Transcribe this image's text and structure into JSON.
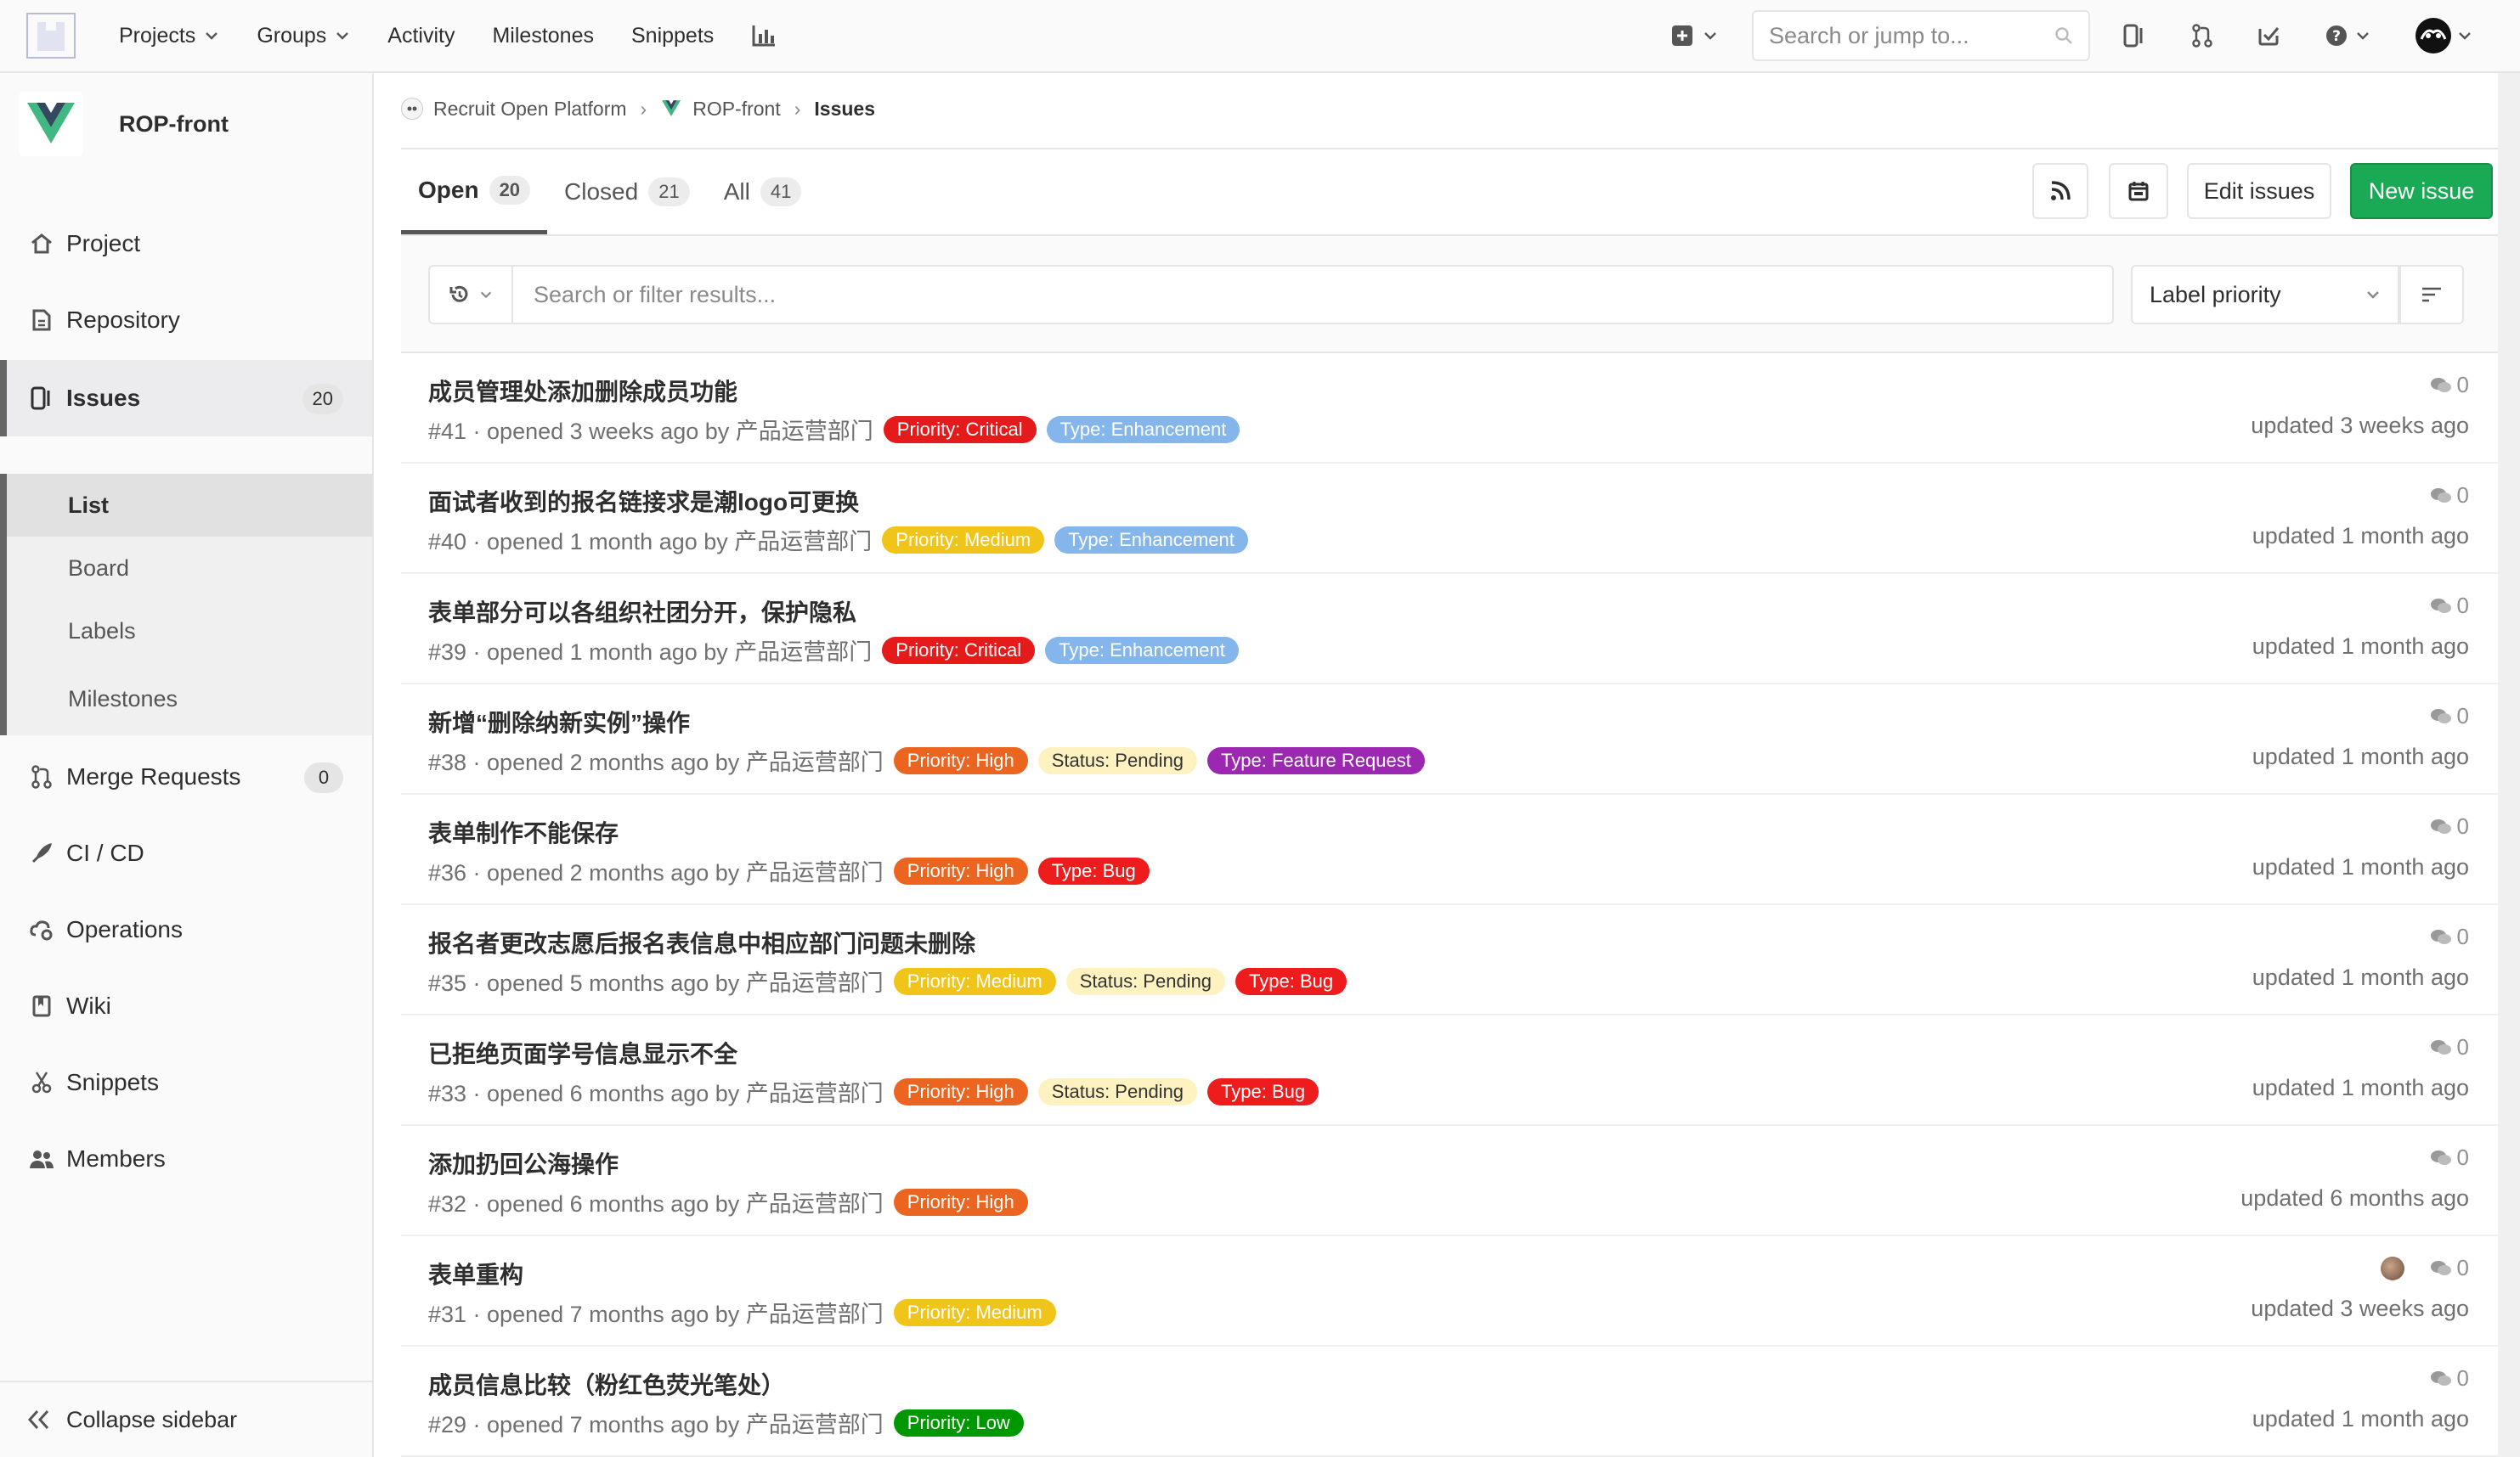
{
  "navbar": {
    "links": [
      "Projects",
      "Groups",
      "Activity",
      "Milestones",
      "Snippets"
    ],
    "search_placeholder": "Search or jump to..."
  },
  "sidebar": {
    "project_name": "ROP-front",
    "items": [
      {
        "label": "Project",
        "icon": "home-icon"
      },
      {
        "label": "Repository",
        "icon": "doc-icon"
      },
      {
        "label": "Issues",
        "icon": "issues-icon",
        "badge": "20"
      },
      {
        "label": "Merge Requests",
        "icon": "merge-request-icon",
        "badge": "0"
      },
      {
        "label": "CI / CD",
        "icon": "rocket-icon"
      },
      {
        "label": "Operations",
        "icon": "cloud-gear-icon"
      },
      {
        "label": "Wiki",
        "icon": "book-icon"
      },
      {
        "label": "Snippets",
        "icon": "scissors-icon"
      },
      {
        "label": "Members",
        "icon": "users-icon"
      }
    ],
    "issue_subitems": [
      "List",
      "Board",
      "Labels",
      "Milestones"
    ],
    "collapse_label": "Collapse sidebar"
  },
  "breadcrumb": {
    "group": "Recruit Open Platform",
    "project": "ROP-front",
    "current": "Issues"
  },
  "tabs": [
    {
      "label": "Open",
      "count": "20"
    },
    {
      "label": "Closed",
      "count": "21"
    },
    {
      "label": "All",
      "count": "41"
    }
  ],
  "buttons": {
    "edit_issues": "Edit issues",
    "new_issue": "New issue"
  },
  "filter": {
    "placeholder": "Search or filter results...",
    "sort_label": "Label priority"
  },
  "colors": {
    "priority_critical": "#e51a1a",
    "priority_high": "#eb6420",
    "priority_medium": "#f0c419",
    "priority_low": "#009800",
    "type_enhancement": "#84b6eb",
    "type_feature": "#9c27b0",
    "type_bug": "#ee1c1c",
    "status_pending": "#fef2c0",
    "primary_green": "#1aaa55"
  },
  "issues": [
    {
      "title": "成员管理处添加删除成员功能",
      "meta": "#41 · opened 3 weeks ago by 产品运营部门",
      "labels": [
        {
          "text": "Priority: Critical",
          "kind": "priority_critical"
        },
        {
          "text": "Type: Enhancement",
          "kind": "type_enhancement"
        }
      ],
      "comments": "0",
      "updated": "updated 3 weeks ago"
    },
    {
      "title": "面试者收到的报名链接求是潮logo可更换",
      "meta": "#40 · opened 1 month ago by 产品运营部门",
      "labels": [
        {
          "text": "Priority: Medium",
          "kind": "priority_medium"
        },
        {
          "text": "Type: Enhancement",
          "kind": "type_enhancement"
        }
      ],
      "comments": "0",
      "updated": "updated 1 month ago"
    },
    {
      "title": "表单部分可以各组织社团分开，保护隐私",
      "meta": "#39 · opened 1 month ago by 产品运营部门",
      "labels": [
        {
          "text": "Priority: Critical",
          "kind": "priority_critical"
        },
        {
          "text": "Type: Enhancement",
          "kind": "type_enhancement"
        }
      ],
      "comments": "0",
      "updated": "updated 1 month ago"
    },
    {
      "title": "新增“删除纳新实例”操作",
      "meta": "#38 · opened 2 months ago by 产品运营部门",
      "labels": [
        {
          "text": "Priority: High",
          "kind": "priority_high"
        },
        {
          "text": "Status: Pending",
          "kind": "status_pending"
        },
        {
          "text": "Type: Feature Request",
          "kind": "type_feature"
        }
      ],
      "comments": "0",
      "updated": "updated 1 month ago"
    },
    {
      "title": "表单制作不能保存",
      "meta": "#36 · opened 2 months ago by 产品运营部门",
      "labels": [
        {
          "text": "Priority: High",
          "kind": "priority_high"
        },
        {
          "text": "Type: Bug",
          "kind": "type_bug"
        }
      ],
      "comments": "0",
      "updated": "updated 1 month ago"
    },
    {
      "title": "报名者更改志愿后报名表信息中相应部门问题未删除",
      "meta": "#35 · opened 5 months ago by 产品运营部门",
      "labels": [
        {
          "text": "Priority: Medium",
          "kind": "priority_medium"
        },
        {
          "text": "Status: Pending",
          "kind": "status_pending"
        },
        {
          "text": "Type: Bug",
          "kind": "type_bug"
        }
      ],
      "comments": "0",
      "updated": "updated 1 month ago"
    },
    {
      "title": "已拒绝页面学号信息显示不全",
      "meta": "#33 · opened 6 months ago by 产品运营部门",
      "labels": [
        {
          "text": "Priority: High",
          "kind": "priority_high"
        },
        {
          "text": "Status: Pending",
          "kind": "status_pending"
        },
        {
          "text": "Type: Bug",
          "kind": "type_bug"
        }
      ],
      "comments": "0",
      "updated": "updated 1 month ago"
    },
    {
      "title": "添加扔回公海操作",
      "meta": "#32 · opened 6 months ago by 产品运营部门",
      "labels": [
        {
          "text": "Priority: High",
          "kind": "priority_high"
        }
      ],
      "comments": "0",
      "updated": "updated 6 months ago"
    },
    {
      "title": "表单重构",
      "meta": "#31 · opened 7 months ago by 产品运营部门",
      "labels": [
        {
          "text": "Priority: Medium",
          "kind": "priority_medium"
        }
      ],
      "comments": "0",
      "updated": "updated 3 weeks ago",
      "assignee": true
    },
    {
      "title": "成员信息比较（粉红色荧光笔处）",
      "meta": "#29 · opened 7 months ago by 产品运营部门",
      "labels": [
        {
          "text": "Priority: Low",
          "kind": "priority_low"
        }
      ],
      "comments": "0",
      "updated": "updated 1 month ago"
    }
  ]
}
